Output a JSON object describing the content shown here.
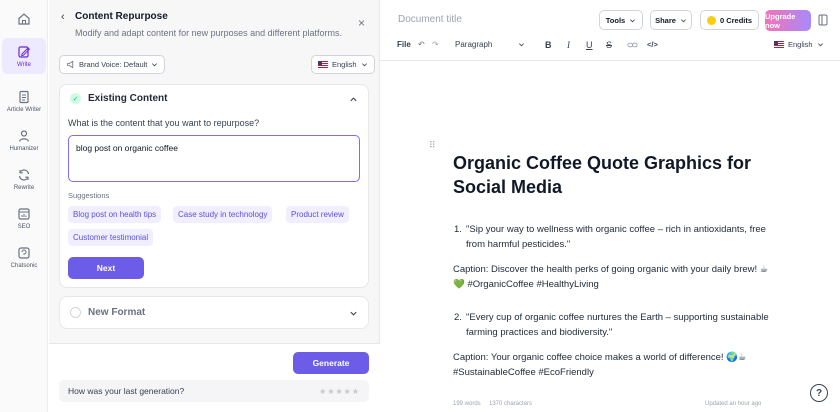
{
  "rail": {
    "items": [
      {
        "label": "Write",
        "icon": "edit-icon"
      },
      {
        "label": "Article Writer",
        "icon": "document-icon"
      },
      {
        "label": "Humanizer",
        "icon": "person-icon"
      },
      {
        "label": "Rewrite",
        "icon": "refresh-icon"
      },
      {
        "label": "SEO",
        "icon": "seo-icon"
      },
      {
        "label": "Chatsonic",
        "icon": "chat-icon"
      }
    ]
  },
  "panel": {
    "back_glyph": "‹",
    "title": "Content Repurpose",
    "subtitle": "Modify and adapt content for new purposes and different platforms.",
    "close_glyph": "×",
    "brand_voice": "Brand Voice: Default",
    "language": "English",
    "existing": {
      "title": "Existing Content",
      "question": "What is the content that you want to repurpose?",
      "value": "blog post on organic coffee",
      "suggestions_label": "Suggestions",
      "suggestions": [
        "Blog post on health tips",
        "Case study in technology",
        "Product review",
        "Customer testimonial"
      ],
      "next_label": "Next"
    },
    "new_format": {
      "title": "New Format"
    },
    "generate_label": "Generate",
    "feedback_question": "How was your last generation?",
    "stars": "★★★★★"
  },
  "editor": {
    "doc_title_placeholder": "Document title",
    "tools_label": "Tools",
    "share_label": "Share",
    "credits_label": "0 Credits",
    "upgrade_label": "Upgrade now",
    "toolbar": {
      "file": "File",
      "undo": "↶",
      "redo": "↷",
      "paragraph": "Paragraph",
      "bold": "B",
      "italic": "I",
      "underline": "U",
      "strike": "S",
      "link": "🔗",
      "code": "</>",
      "language": "English"
    },
    "heading": "Organic Coffee Quote Graphics for Social Media",
    "items": [
      {
        "num": "1.",
        "text": "\"Sip your way to wellness with organic coffee – rich in antioxidants, free from harmful pesticides.\""
      },
      {
        "num": "2.",
        "text": "\"Every cup of organic coffee nurtures the Earth – supporting sustainable farming practices and biodiversity.\""
      }
    ],
    "captions": [
      "Caption: Discover the health perks of going organic with your daily brew! ☕💚 #OrganicCoffee #HealthyLiving",
      "Caption: Your organic coffee choice makes a world of difference! 🌍☕ #SustainableCoffee #EcoFriendly"
    ],
    "status": {
      "words": "199 words",
      "characters": "1370 characters",
      "updated": "Updated an hour ago"
    },
    "help_glyph": "?"
  }
}
